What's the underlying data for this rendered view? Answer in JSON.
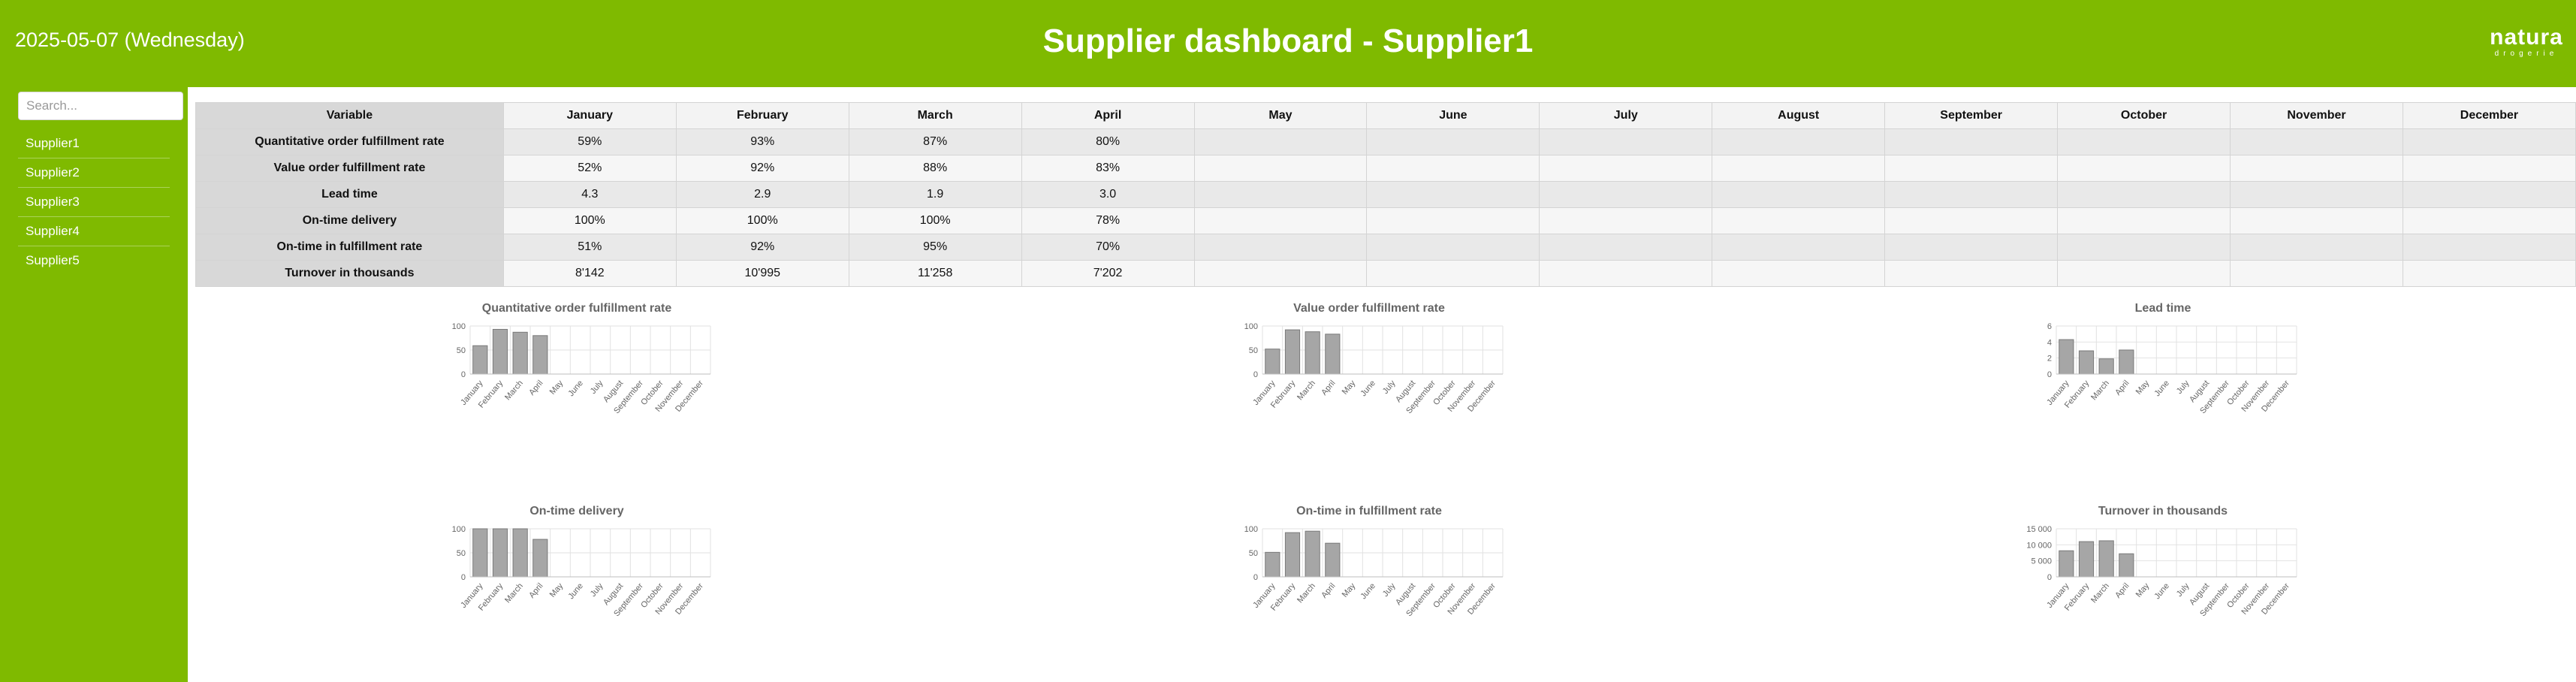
{
  "header": {
    "date": "2025-05-07 (Wednesday)",
    "title": "Supplier dashboard - Supplier1",
    "logo_text": "natura",
    "logo_subtext": "drogerie"
  },
  "sidebar": {
    "search_placeholder": "Search...",
    "items": [
      {
        "label": "Supplier1"
      },
      {
        "label": "Supplier2"
      },
      {
        "label": "Supplier3"
      },
      {
        "label": "Supplier4"
      },
      {
        "label": "Supplier5"
      }
    ]
  },
  "table": {
    "header": [
      "Variable",
      "January",
      "February",
      "March",
      "April",
      "May",
      "June",
      "July",
      "August",
      "September",
      "October",
      "November",
      "December"
    ],
    "rows": [
      {
        "label": "Quantitative order fulfillment rate",
        "cells": [
          "59%",
          "93%",
          "87%",
          "80%",
          "",
          "",
          "",
          "",
          "",
          "",
          "",
          ""
        ]
      },
      {
        "label": "Value order fulfillment rate",
        "cells": [
          "52%",
          "92%",
          "88%",
          "83%",
          "",
          "",
          "",
          "",
          "",
          "",
          "",
          ""
        ]
      },
      {
        "label": "Lead time",
        "cells": [
          "4.3",
          "2.9",
          "1.9",
          "3.0",
          "",
          "",
          "",
          "",
          "",
          "",
          "",
          ""
        ]
      },
      {
        "label": "On-time delivery",
        "cells": [
          "100%",
          "100%",
          "100%",
          "78%",
          "",
          "",
          "",
          "",
          "",
          "",
          "",
          ""
        ]
      },
      {
        "label": "On-time in fulfillment rate",
        "cells": [
          "51%",
          "92%",
          "95%",
          "70%",
          "",
          "",
          "",
          "",
          "",
          "",
          "",
          ""
        ]
      },
      {
        "label": "Turnover in thousands",
        "cells": [
          "8'142",
          "10'995",
          "11'258",
          "7'202",
          "",
          "",
          "",
          "",
          "",
          "",
          "",
          ""
        ]
      }
    ]
  },
  "colors": {
    "brand": "#7fba00",
    "bar_fill": "#a6a6a6",
    "bar_stroke": "#7a7a7a",
    "grid": "#e2e2e2"
  },
  "chart_data": [
    {
      "type": "bar",
      "title": "Quantitative order fulfillment rate",
      "categories": [
        "January",
        "February",
        "March",
        "April",
        "May",
        "June",
        "July",
        "August",
        "September",
        "October",
        "November",
        "December"
      ],
      "values": [
        59,
        93,
        87,
        80,
        null,
        null,
        null,
        null,
        null,
        null,
        null,
        null
      ],
      "ylim": [
        0,
        100
      ],
      "yticks": [
        "0",
        "50",
        "100"
      ],
      "grid": true
    },
    {
      "type": "bar",
      "title": "Value order fulfillment rate",
      "categories": [
        "January",
        "February",
        "March",
        "April",
        "May",
        "June",
        "July",
        "August",
        "September",
        "October",
        "November",
        "December"
      ],
      "values": [
        52,
        92,
        88,
        83,
        null,
        null,
        null,
        null,
        null,
        null,
        null,
        null
      ],
      "ylim": [
        0,
        100
      ],
      "yticks": [
        "0",
        "50",
        "100"
      ],
      "grid": true
    },
    {
      "type": "bar",
      "title": "Lead time",
      "categories": [
        "January",
        "February",
        "March",
        "April",
        "May",
        "June",
        "July",
        "August",
        "September",
        "October",
        "November",
        "December"
      ],
      "values": [
        4.3,
        2.9,
        1.9,
        3.0,
        null,
        null,
        null,
        null,
        null,
        null,
        null,
        null
      ],
      "ylim": [
        0,
        6
      ],
      "yticks": [
        "0",
        "2",
        "4",
        "6"
      ],
      "grid": true
    },
    {
      "type": "bar",
      "title": "On-time delivery",
      "categories": [
        "January",
        "February",
        "March",
        "April",
        "May",
        "June",
        "July",
        "August",
        "September",
        "October",
        "November",
        "December"
      ],
      "values": [
        100,
        100,
        100,
        78,
        null,
        null,
        null,
        null,
        null,
        null,
        null,
        null
      ],
      "ylim": [
        0,
        100
      ],
      "yticks": [
        "0",
        "50",
        "100"
      ],
      "grid": true
    },
    {
      "type": "bar",
      "title": "On-time in fulfillment rate",
      "categories": [
        "January",
        "February",
        "March",
        "April",
        "May",
        "June",
        "July",
        "August",
        "September",
        "October",
        "November",
        "December"
      ],
      "values": [
        51,
        92,
        95,
        70,
        null,
        null,
        null,
        null,
        null,
        null,
        null,
        null
      ],
      "ylim": [
        0,
        100
      ],
      "yticks": [
        "0",
        "50",
        "100"
      ],
      "grid": true
    },
    {
      "type": "bar",
      "title": "Turnover in thousands",
      "categories": [
        "January",
        "February",
        "March",
        "April",
        "May",
        "June",
        "July",
        "August",
        "September",
        "October",
        "November",
        "December"
      ],
      "values": [
        8142,
        10995,
        11258,
        7202,
        null,
        null,
        null,
        null,
        null,
        null,
        null,
        null
      ],
      "ylim": [
        0,
        15000
      ],
      "yticks": [
        "0",
        "5 000",
        "10 000",
        "15 000"
      ],
      "grid": true
    }
  ]
}
